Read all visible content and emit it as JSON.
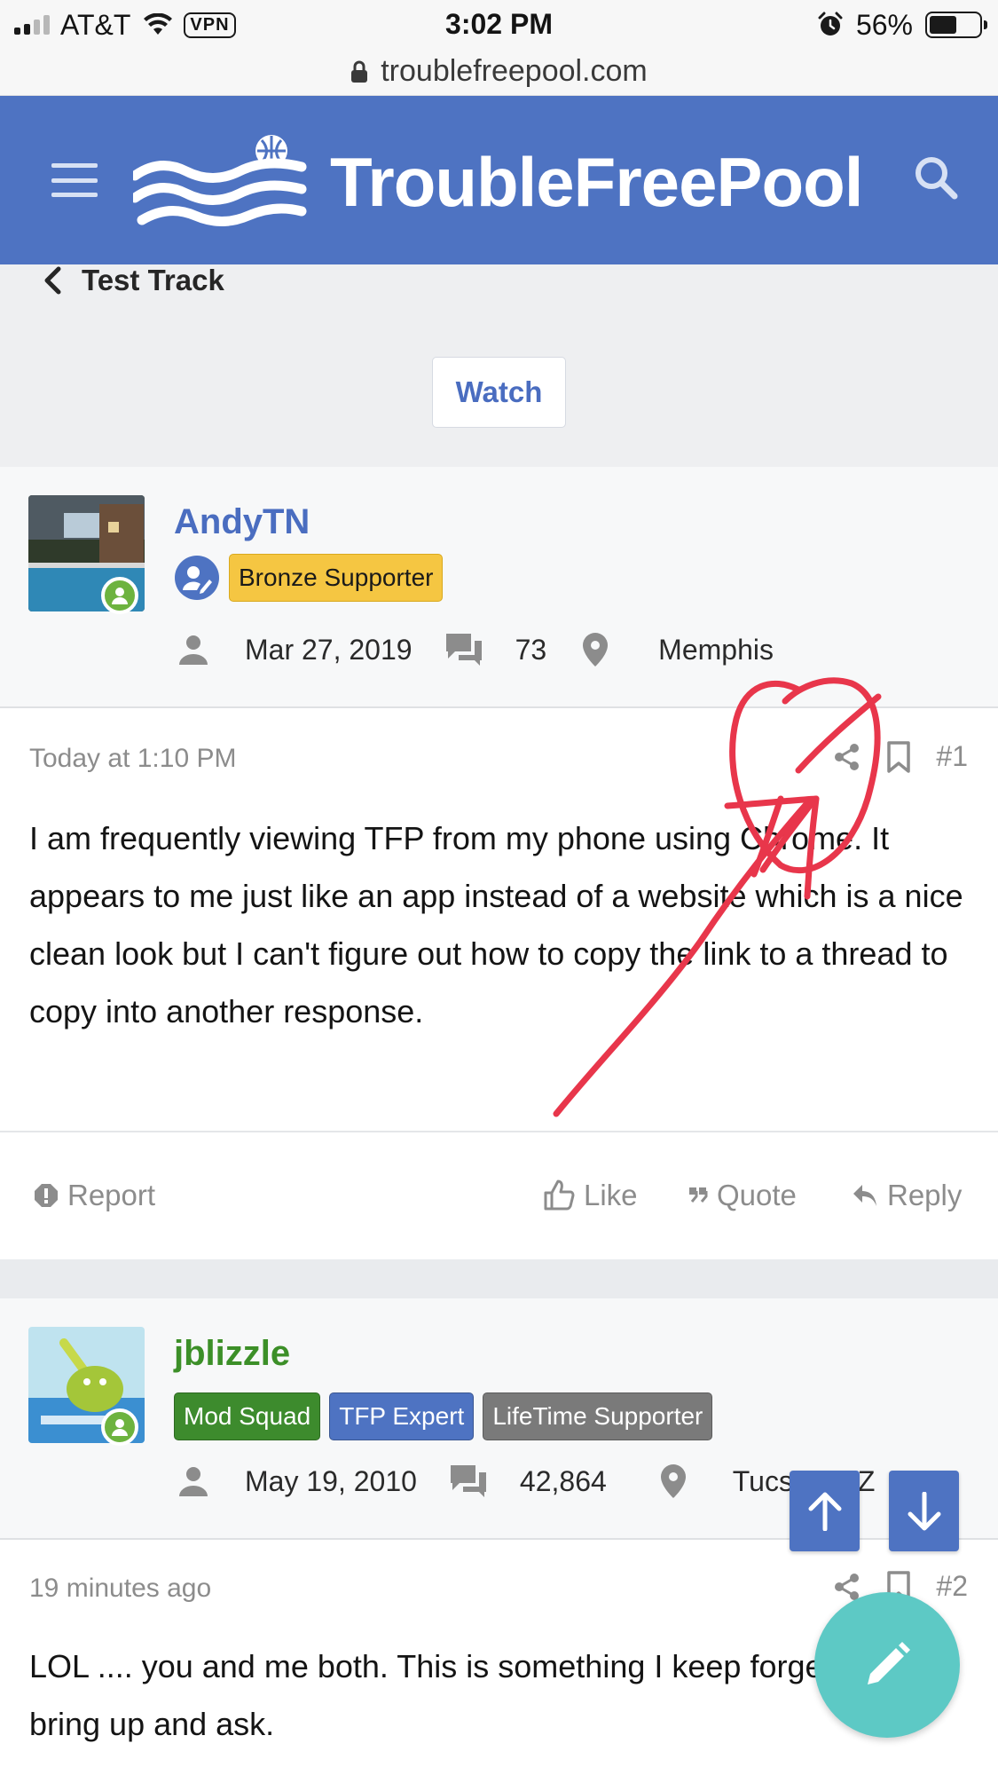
{
  "status_bar": {
    "carrier": "AT&T",
    "vpn": "VPN",
    "time": "3:02 PM",
    "battery": "56%",
    "battery_level": 0.56
  },
  "browser": {
    "url": "troublefreepool.com"
  },
  "header": {
    "brand": "TroubleFreePool",
    "accent_color": "#4e73c2"
  },
  "breadcrumb": {
    "label": "Test Track"
  },
  "watch": {
    "label": "Watch"
  },
  "posts": [
    {
      "username": "AndyTN",
      "username_color": "#4a6dc0",
      "badges": [
        {
          "label": "Bronze Supporter",
          "bg": "#f5c642",
          "fg": "#1a1a1a"
        }
      ],
      "joined": "Mar 27, 2019",
      "messages": "73",
      "location": "Memphis",
      "date": "Today at 1:10 PM",
      "number": "#1",
      "text": "I am frequently viewing TFP from my phone using Chrome. It appears to me just like an app instead of a website which is a nice clean look but I can't figure out how to copy the link to a thread to copy into another response.",
      "footer": {
        "report": "Report",
        "like": "Like",
        "quote": "Quote",
        "reply": "Reply"
      }
    },
    {
      "username": "jblizzle",
      "username_color": "#3c8f28",
      "badges": [
        {
          "label": "Mod Squad",
          "bg": "#3d8b2d",
          "fg": "#ffffff"
        },
        {
          "label": "TFP Expert",
          "bg": "#4e73c2",
          "fg": "#ffffff"
        },
        {
          "label": "LifeTime Supporter",
          "bg": "#7a7a7a",
          "fg": "#ffffff"
        }
      ],
      "joined": "May 19, 2010",
      "messages": "42,864",
      "location": "Tucson, AZ",
      "date": "19 minutes ago",
      "number": "#2",
      "text": "LOL .... you and me both. This is something I keep forgetting to bring up and ask."
    }
  ]
}
